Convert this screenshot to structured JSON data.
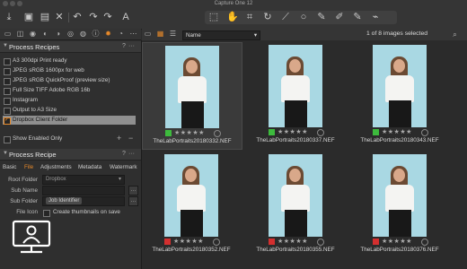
{
  "window": {
    "title": "Capture One 12"
  },
  "toolbar": {
    "left_icons": [
      "import-icon",
      "camera-icon",
      "folder-icon",
      "delete-icon",
      "undo-icon",
      "redo-icon",
      "adjust-icon"
    ],
    "cursor_tools": [
      "select-tool-icon",
      "pan-tool-icon",
      "crop-tool-icon",
      "rotate-tool-icon",
      "keystone-tool-icon",
      "spot-remove-icon",
      "brush-icon",
      "eraser-icon",
      "gradient-icon",
      "picker-icon"
    ],
    "accent_color": "#e88a2a"
  },
  "tool_tabs": [
    "library-tab-icon",
    "capture-tab-icon",
    "lens-tab-icon",
    "color-tab-icon",
    "exposure-tab-icon",
    "details-tab-icon",
    "adjustments-tab-icon",
    "metadata-tab-icon",
    "output-tab-icon",
    "batch-tab-icon"
  ],
  "process_recipes": {
    "title": "Process Recipes",
    "help": "?",
    "more": "···",
    "items": [
      {
        "label": "A3 300dpi Print ready",
        "checked": false,
        "selected": false
      },
      {
        "label": "JPEG sRGB 1600px for web",
        "checked": false,
        "selected": false
      },
      {
        "label": "JPEG sRGB QuickProof (preview size)",
        "checked": false,
        "selected": false
      },
      {
        "label": "Full Size TIFF Adobe RGB 16b",
        "checked": false,
        "selected": false
      },
      {
        "label": "Instagram",
        "checked": false,
        "selected": false
      },
      {
        "label": "Output to A3 Size",
        "checked": false,
        "selected": false
      },
      {
        "label": "Dropbox Client Folder",
        "checked": true,
        "selected": true
      }
    ],
    "show_enabled_label": "Show Enabled Only",
    "add": "+",
    "remove": "−"
  },
  "process_recipe": {
    "title": "Process Recipe",
    "help": "?",
    "more": "···",
    "tabs": [
      "Basic",
      "File",
      "Adjustments",
      "Metadata",
      "Watermark"
    ],
    "active_tab": "File",
    "fields": {
      "root_folder_label": "Root Folder",
      "root_folder_value": "Dropbox",
      "sub_name_label": "Sub Name",
      "sub_name_value": "",
      "sub_folder_label": "Sub Folder",
      "sub_folder_badge": "Job Identifier",
      "file_icon_label": "File Icon",
      "thumbnails_label": "Create thumbnails on save"
    }
  },
  "browser": {
    "sort_field": "Name",
    "selection_status": "1 of 8 images selected",
    "thumbnails": [
      {
        "filename": "TheLabPortraits20180332.NEF",
        "label_color": "#3dbb3d",
        "stars": "★★★★★",
        "selected": true
      },
      {
        "filename": "TheLabPortraits20180337.NEF",
        "label_color": "#3dbb3d",
        "stars": "★★★★★",
        "selected": false
      },
      {
        "filename": "TheLabPortraits20180343.NEF",
        "label_color": "#3dbb3d",
        "stars": "★★★★★",
        "selected": false
      },
      {
        "filename": "TheLabPortraits20180352.NEF",
        "label_color": "#d32f2f",
        "stars": "★★★★★",
        "selected": false
      },
      {
        "filename": "TheLabPortraits20180355.NEF",
        "label_color": "#d32f2f",
        "stars": "★★★★★",
        "selected": false
      },
      {
        "filename": "TheLabPortraits20180376.NEF",
        "label_color": "#d32f2f",
        "stars": "★★★★★",
        "selected": false
      }
    ]
  }
}
